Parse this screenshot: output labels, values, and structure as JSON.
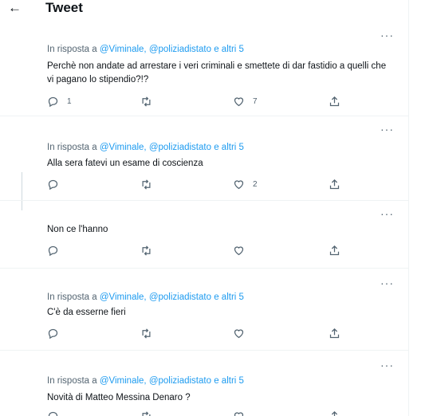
{
  "header": {
    "back_icon": "arrow-left-icon",
    "title": "Tweet"
  },
  "replying": {
    "prefix": "In risposta a",
    "mention1": "@Viminale,",
    "mention2": "@poliziadistato",
    "and_others": "e altri 5"
  },
  "tweets": [
    {
      "text": "Perchè non andate ad arrestare i veri criminali e smettete di dar fastidio a quelli che vi pagano lo stipendio?!?",
      "replies": "1",
      "retweets": "",
      "likes": "7"
    },
    {
      "text": "Alla sera fatevi un esame di coscienza",
      "replies": "",
      "retweets": "",
      "likes": "2"
    },
    {
      "text": "Non ce l'hanno",
      "replies": "",
      "retweets": "",
      "likes": ""
    },
    {
      "text": "C'è da esserne fieri",
      "replies": "",
      "retweets": "",
      "likes": ""
    },
    {
      "text": "Novità di Matteo Messina Denaro ?",
      "replies": "",
      "retweets": "",
      "likes": ""
    }
  ],
  "more_label": "···",
  "colors": {
    "accent": "#1d9bf0",
    "muted": "#536471",
    "text": "#0f1419"
  }
}
